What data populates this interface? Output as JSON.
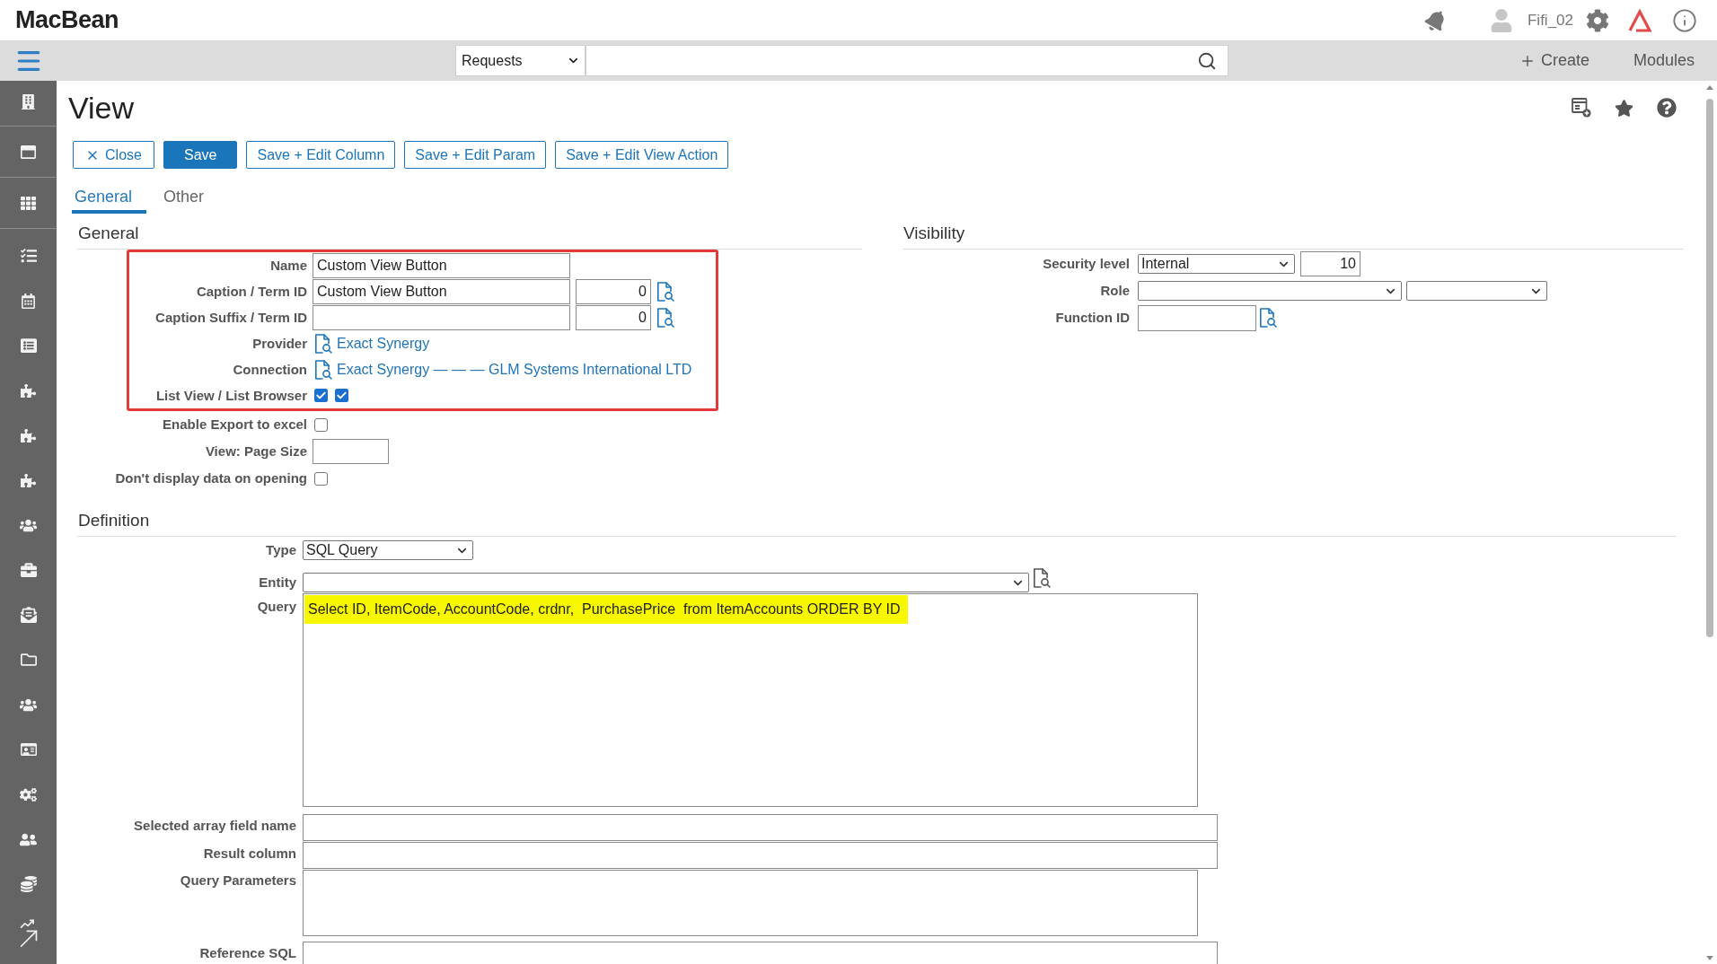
{
  "header": {
    "app_name": "MacBean",
    "user_name": "Fifi_02"
  },
  "nav": {
    "search_scope": "Requests",
    "create_label": "Create",
    "modules_label": "Modules"
  },
  "page": {
    "title": "View",
    "buttons": [
      {
        "label": "Close",
        "kind": "close"
      },
      {
        "label": "Save",
        "kind": "primary"
      },
      {
        "label": "Save + Edit Column",
        "kind": "secondary"
      },
      {
        "label": "Save + Edit Param",
        "kind": "secondary"
      },
      {
        "label": "Save + Edit View Action",
        "kind": "secondary"
      }
    ],
    "tabs": [
      {
        "label": "General",
        "selected": true
      },
      {
        "label": "Other",
        "selected": false
      }
    ]
  },
  "general": {
    "title": "General",
    "highlighted_fields": [
      {
        "label": "Name",
        "kind": "text",
        "value": "Custom View Button"
      },
      {
        "label": "Caption / Term ID",
        "kind": "text_term",
        "value": "Custom View Button",
        "term_id": "0"
      },
      {
        "label": "Caption Suffix / Term ID",
        "kind": "text_term",
        "term_id": "0"
      },
      {
        "label": "Provider",
        "kind": "link",
        "value": "Exact Synergy"
      },
      {
        "label": "Connection",
        "kind": "link",
        "value": "Exact Synergy — — — GLM Systems International LTD"
      },
      {
        "label": "List View / List Browser",
        "kind": "checkboxes",
        "checks": [
          {
            "checked": true
          },
          {
            "checked": true
          }
        ]
      }
    ],
    "fields": [
      {
        "label": "Enable Export to excel",
        "kind": "checkbox",
        "checked": false
      },
      {
        "label": "View: Page Size",
        "kind": "short_text"
      },
      {
        "label": "Don't display data on opening",
        "kind": "checkbox",
        "checked": false
      }
    ]
  },
  "visibility": {
    "title": "Visibility",
    "fields": [
      {
        "label": "Security level",
        "kind": "select_number",
        "value": "Internal",
        "number": "10"
      },
      {
        "label": "Role",
        "kind": "two_selects"
      },
      {
        "label": "Function ID",
        "kind": "lookup"
      }
    ]
  },
  "definition": {
    "title": "Definition",
    "fields": [
      {
        "label": "Type",
        "kind": "select",
        "value": "SQL Query"
      },
      {
        "label": "Entity",
        "kind": "select_lookup"
      },
      {
        "label": "Query",
        "kind": "code",
        "value": "Select ID, ItemCode, AccountCode, crdnr,  PurchasePrice  from ItemAccounts ORDER BY ID",
        "highlighted": true
      },
      {
        "label": "Selected array field name",
        "kind": "wide_text"
      },
      {
        "label": "Result column",
        "kind": "wide_text"
      },
      {
        "label": "Query Parameters",
        "kind": "textarea"
      },
      {
        "label": "Reference SQL",
        "kind": "wide_text"
      }
    ]
  }
}
